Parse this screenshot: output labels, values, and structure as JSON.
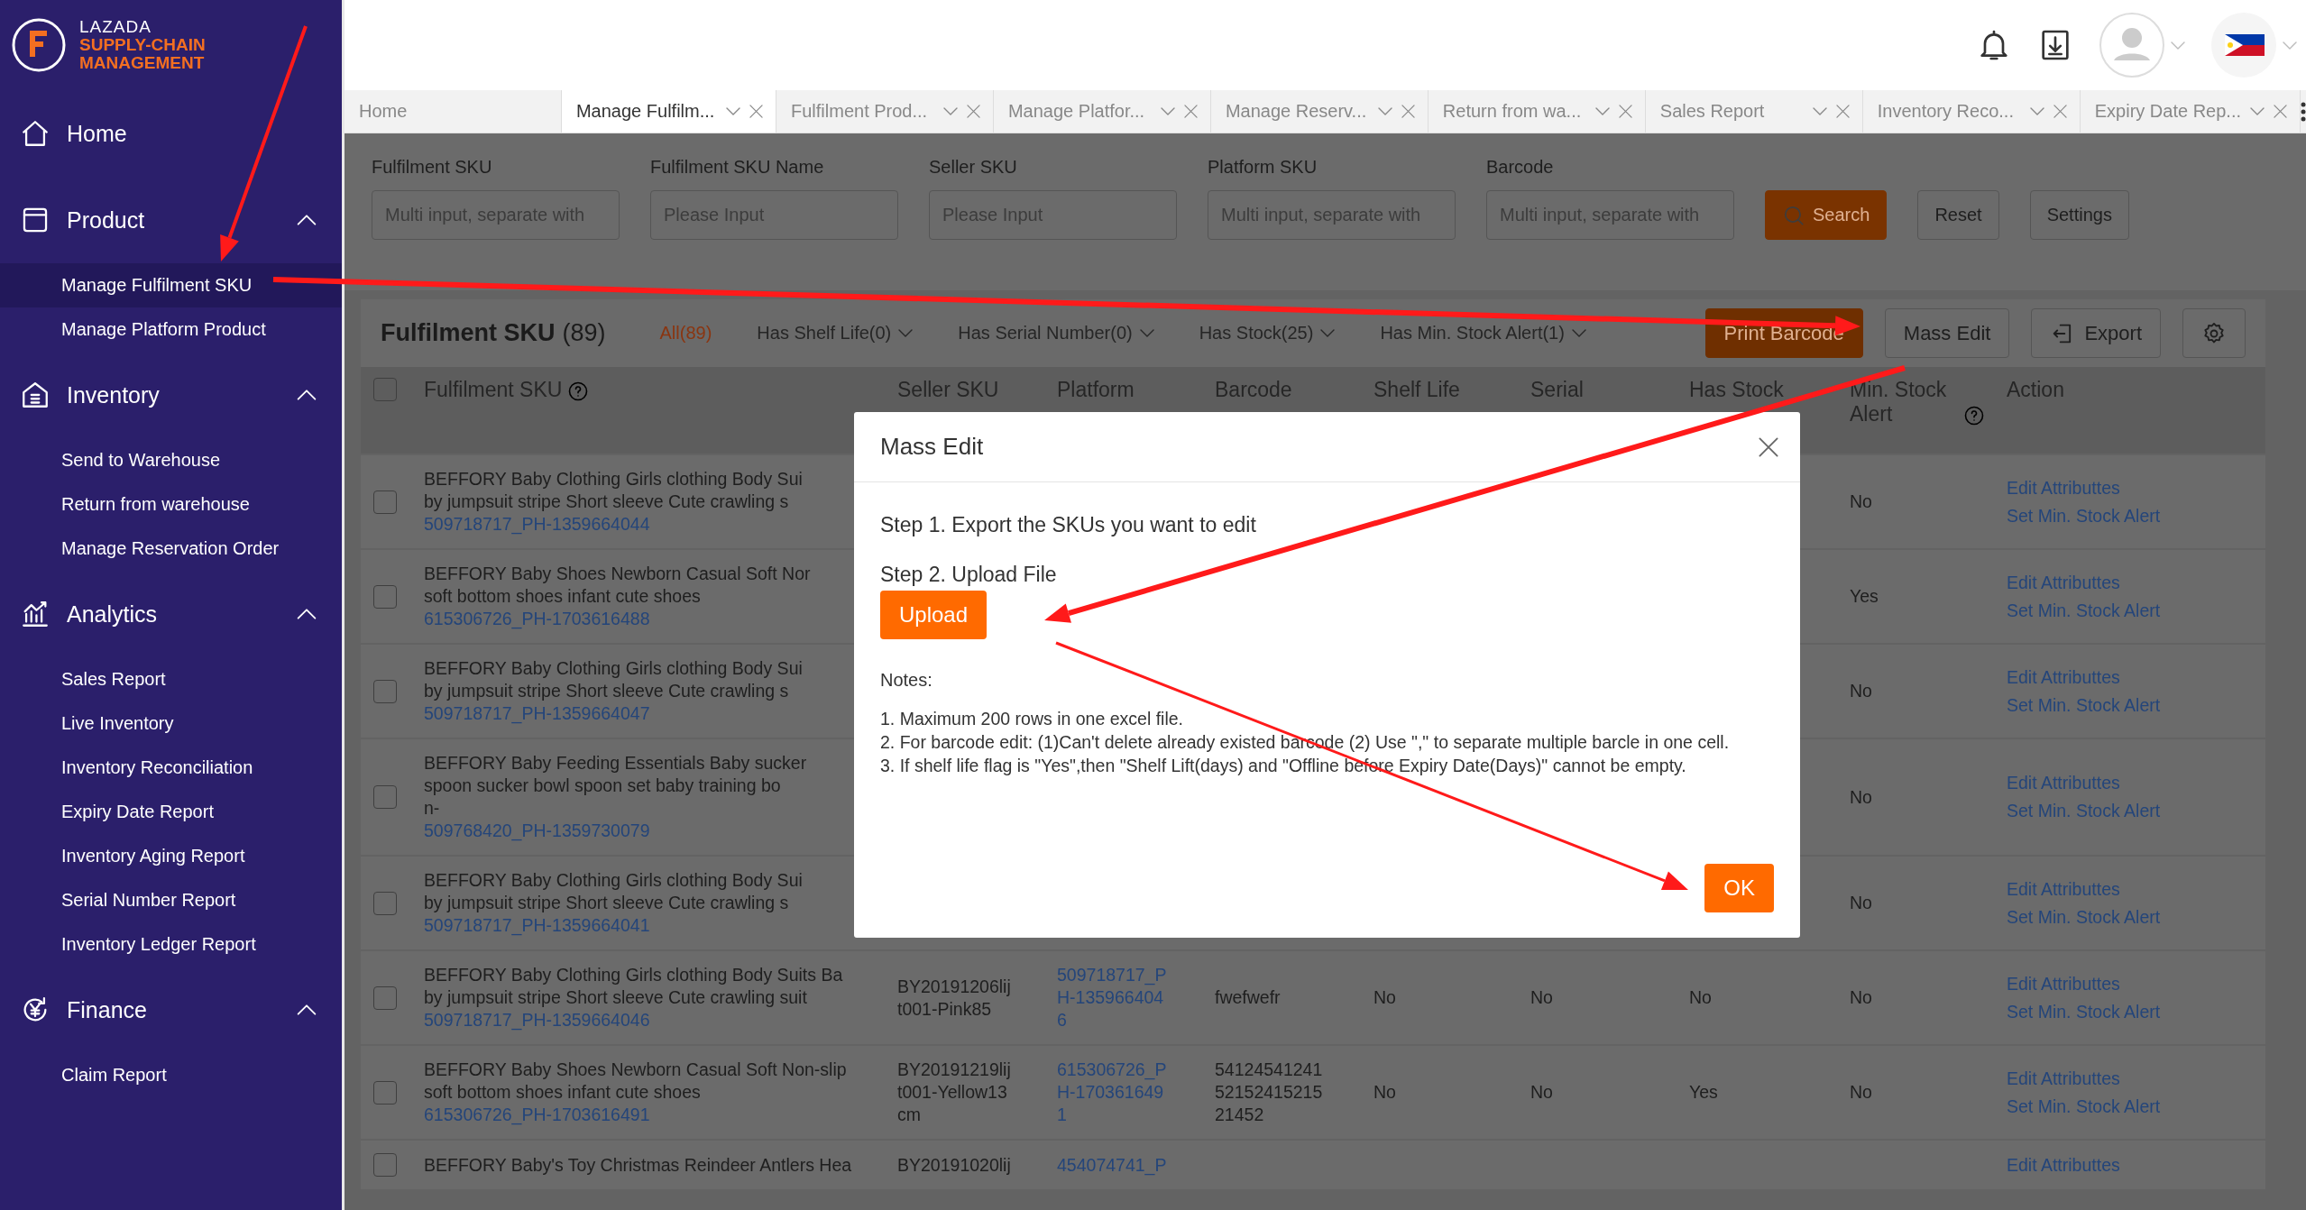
{
  "sidebar": {
    "logo": {
      "brand": "LAZADA",
      "line1": "SUPPLY-CHAIN",
      "line2": "MANAGEMENT"
    },
    "sections": [
      {
        "kind": "home",
        "label": "Home"
      },
      {
        "kind": "product",
        "label": "Product",
        "expanded": true,
        "items": [
          {
            "label": "Manage Fulfilment SKU",
            "selected": true
          },
          {
            "label": "Manage Platform Product",
            "selected": false
          }
        ]
      },
      {
        "kind": "inventory",
        "label": "Inventory",
        "expanded": true,
        "items": [
          {
            "label": "Send to Warehouse",
            "selected": false
          },
          {
            "label": "Return from warehouse",
            "selected": false
          },
          {
            "label": "Manage Reservation Order",
            "selected": false
          }
        ]
      },
      {
        "kind": "analytics",
        "label": "Analytics",
        "expanded": true,
        "items": [
          {
            "label": "Sales Report",
            "selected": false
          },
          {
            "label": "Live Inventory",
            "selected": false
          },
          {
            "label": "Inventory Reconciliation",
            "selected": false
          },
          {
            "label": "Expiry Date Report",
            "selected": false
          },
          {
            "label": "Inventory Aging Report",
            "selected": false
          },
          {
            "label": "Serial Number Report",
            "selected": false
          },
          {
            "label": "Inventory Ledger Report",
            "selected": false
          }
        ]
      },
      {
        "kind": "finance",
        "label": "Finance",
        "expanded": true,
        "items": [
          {
            "label": "Claim Report",
            "selected": false
          }
        ]
      }
    ]
  },
  "tabs": [
    {
      "label": "Home",
      "selected": false,
      "closable": false
    },
    {
      "label": "Manage Fulfilm...",
      "selected": true,
      "closable": true
    },
    {
      "label": "Fulfilment Prod...",
      "selected": false,
      "closable": true
    },
    {
      "label": "Manage Platfor...",
      "selected": false,
      "closable": true
    },
    {
      "label": "Manage Reserv...",
      "selected": false,
      "closable": true
    },
    {
      "label": "Return from wa...",
      "selected": false,
      "closable": true
    },
    {
      "label": "Sales Report",
      "selected": false,
      "closable": true
    },
    {
      "label": "Inventory Reco...",
      "selected": false,
      "closable": true
    },
    {
      "label": "Expiry Date Rep...",
      "selected": false,
      "closable": true
    }
  ],
  "filters": [
    {
      "label": "Fulfilment SKU",
      "placeholder": "Multi input, separate with"
    },
    {
      "label": "Fulfilment SKU Name",
      "placeholder": "Please Input"
    },
    {
      "label": "Seller SKU",
      "placeholder": "Please Input"
    },
    {
      "label": "Platform SKU",
      "placeholder": "Multi input, separate with"
    },
    {
      "label": "Barcode",
      "placeholder": "Multi input, separate with"
    }
  ],
  "filter_buttons": {
    "search": "Search",
    "reset": "Reset",
    "settings": "Settings"
  },
  "toolbar": {
    "title": "Fulfilment SKU",
    "count": "(89)",
    "chips": [
      {
        "label": "All(89)",
        "selected": true,
        "dropdown": false
      },
      {
        "label": "Has Shelf Life(0)",
        "selected": false,
        "dropdown": true
      },
      {
        "label": "Has Serial Number(0)",
        "selected": false,
        "dropdown": true
      },
      {
        "label": "Has Stock(25)",
        "selected": false,
        "dropdown": true
      },
      {
        "label": "Has Min. Stock Alert(1)",
        "selected": false,
        "dropdown": true
      }
    ],
    "print": "Print Barcode",
    "mass_edit": "Mass Edit",
    "export": "Export"
  },
  "table": {
    "all_checked": false,
    "columns": [
      {
        "label": "Fulfilment SKU",
        "help": true
      },
      {
        "label": "Seller SKU"
      },
      {
        "label": "Platform"
      },
      {
        "label": "Barcode"
      },
      {
        "label": "Shelf Life"
      },
      {
        "label": "Serial"
      },
      {
        "label": "Has Stock"
      },
      {
        "label": "Min. Stock Alert",
        "help": true
      },
      {
        "label": "Action"
      }
    ],
    "rows": [
      {
        "checked": false,
        "name_lines": [
          "BEFFORY Baby Clothing Girls clothing Body Sui",
          "by jumpsuit stripe Short sleeve Cute crawling s"
        ],
        "sku": "509718717_PH-1359664044",
        "min_alert": "No",
        "actions": [
          "Edit Attributtes",
          "Set Min. Stock Alert"
        ]
      },
      {
        "checked": false,
        "name_lines": [
          "BEFFORY Baby Shoes Newborn Casual Soft Nor",
          "soft bottom shoes infant cute shoes"
        ],
        "sku": "615306726_PH-1703616488",
        "min_alert": "Yes",
        "actions": [
          "Edit Attributtes",
          "Set Min. Stock Alert"
        ]
      },
      {
        "checked": false,
        "name_lines": [
          "BEFFORY Baby Clothing Girls clothing Body Sui",
          "by jumpsuit stripe Short sleeve Cute crawling s"
        ],
        "sku": "509718717_PH-1359664047",
        "min_alert": "No",
        "actions": [
          "Edit Attributtes",
          "Set Min. Stock Alert"
        ]
      },
      {
        "checked": false,
        "name_lines": [
          "BEFFORY Baby Feeding Essentials Baby sucker",
          "spoon sucker bowl spoon set baby training bo",
          "n-"
        ],
        "sku": "509768420_PH-1359730079",
        "min_alert": "No",
        "actions": [
          "Edit Attributtes",
          "Set Min. Stock Alert"
        ]
      },
      {
        "checked": false,
        "name_lines": [
          "BEFFORY Baby Clothing Girls clothing Body Sui",
          "by jumpsuit stripe Short sleeve Cute crawling s"
        ],
        "sku": "509718717_PH-1359664041",
        "min_alert": "No",
        "actions": [
          "Edit Attributtes",
          "Set Min. Stock Alert"
        ]
      },
      {
        "checked": false,
        "name_lines": [
          "BEFFORY Baby Clothing Girls clothing Body Suits Ba",
          "by jumpsuit stripe Short sleeve Cute crawling suit"
        ],
        "sku": "509718717_PH-1359664046",
        "seller_sku": [
          "BY20191206lij",
          "t001-Pink85"
        ],
        "platform": [
          "509718717_P",
          "H-135966404",
          "6"
        ],
        "barcode": [
          "fwefwefr"
        ],
        "shelf_life": "No",
        "serial": "No",
        "has_stock": "No",
        "min_alert": "No",
        "actions": [
          "Edit Attributtes",
          "Set Min. Stock Alert"
        ]
      },
      {
        "checked": false,
        "name_lines": [
          "BEFFORY Baby Shoes Newborn Casual Soft Non-slip",
          "soft bottom shoes infant cute shoes"
        ],
        "sku": "615306726_PH-1703616491",
        "seller_sku": [
          "BY20191219lij",
          "t001-Yellow13",
          "cm"
        ],
        "platform": [
          "615306726_P",
          "H-170361649",
          "1"
        ],
        "barcode": [
          "54124541241",
          "52152415215",
          "21452"
        ],
        "shelf_life": "No",
        "serial": "No",
        "has_stock": "Yes",
        "min_alert": "No",
        "actions": [
          "Edit Attributtes",
          "Set Min. Stock Alert"
        ]
      },
      {
        "checked": false,
        "name_lines": [
          "BEFFORY Baby's Toy Christmas Reindeer Antlers Hea"
        ],
        "seller_sku": [
          "BY20191020lij"
        ],
        "platform": [
          "454074741_P"
        ],
        "actions": [
          "Edit Attributtes"
        ]
      }
    ]
  },
  "modal": {
    "title": "Mass Edit",
    "step1": "Step 1. Export the SKUs you want to edit",
    "step2": "Step 2. Upload File",
    "upload": "Upload",
    "notes_title": "Notes:",
    "notes": [
      "1. Maximum 200 rows in one excel file.",
      "2. For barcode edit: (1)Can't delete already existed barcode (2) Use \",\" to separate multiple barcle in one cell.",
      "3. If shelf life flag is \"Yes\",then \"Shelf Lift(days) and \"Offline before Expiry Date(Days)\" cannot be empty."
    ],
    "ok": "OK"
  }
}
